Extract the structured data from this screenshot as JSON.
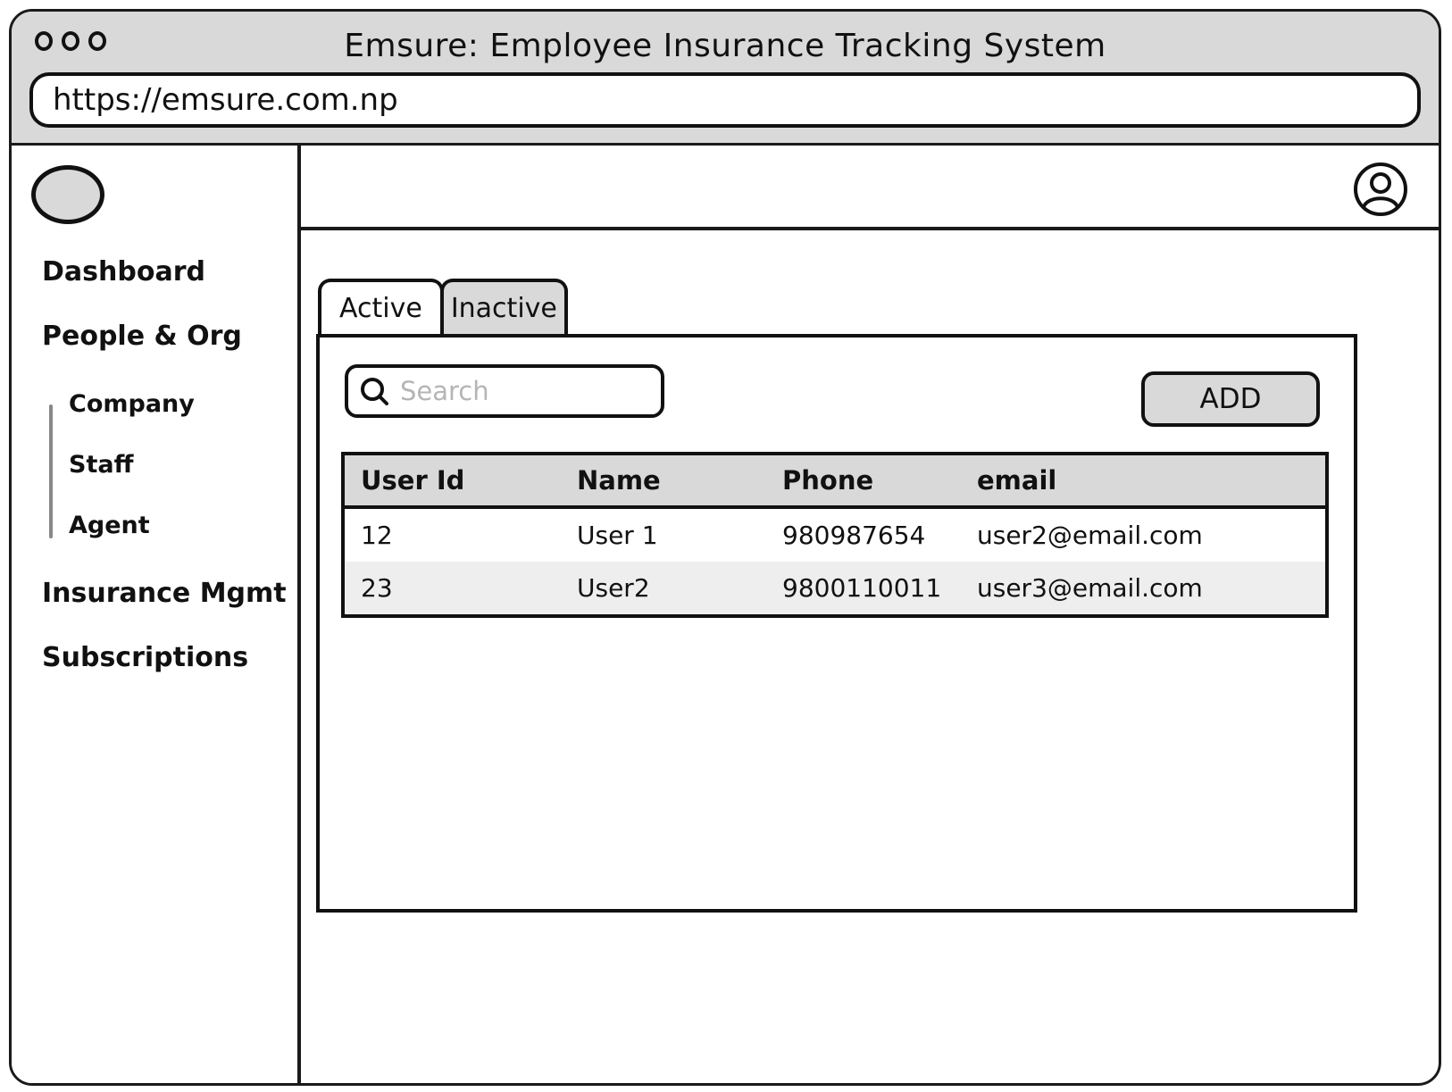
{
  "window": {
    "title": "Emsure: Employee Insurance Tracking System",
    "url": "https://emsure.com.np"
  },
  "sidebar": {
    "items": [
      {
        "label": "Dashboard"
      },
      {
        "label": "People & Org"
      },
      {
        "label": "Insurance Mgmt"
      },
      {
        "label": "Subscriptions"
      }
    ],
    "sub_items": [
      {
        "label": "Company"
      },
      {
        "label": "Staff"
      },
      {
        "label": "Agent"
      }
    ]
  },
  "tabs": [
    {
      "label": "Active",
      "selected": true
    },
    {
      "label": "Inactive",
      "selected": false
    }
  ],
  "search": {
    "placeholder": "Search"
  },
  "add_button": {
    "label": "ADD"
  },
  "table": {
    "headers": [
      "User Id",
      "Name",
      "Phone",
      "email"
    ],
    "rows": [
      [
        "12",
        "User 1",
        "980987654",
        "user2@email.com"
      ],
      [
        "23",
        "User2",
        "9800110011",
        "user3@email.com"
      ]
    ]
  },
  "colors": {
    "chrome_gray": "#d9d9d9",
    "stroke": "#111111",
    "placeholder": "#b5b5b5",
    "row_alt": "#eeeeee"
  },
  "icons": [
    "window-control-icon",
    "avatar-icon",
    "search-icon",
    "logo-placeholder"
  ]
}
